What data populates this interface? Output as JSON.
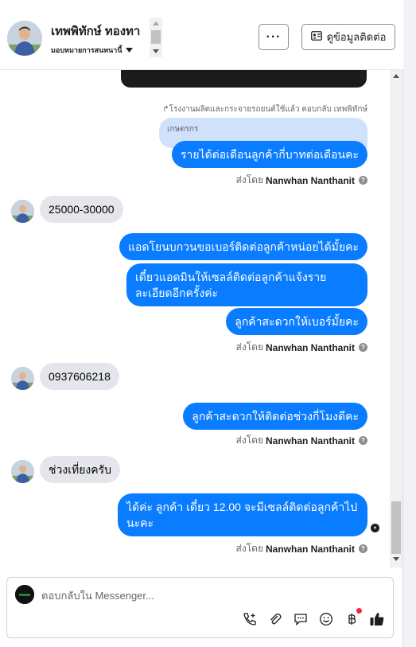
{
  "header": {
    "name": "เทพพิทักษ์ ทองทา",
    "assign_label": "มอบหมายการสนทนานี้",
    "more_label": "···",
    "contact_button_label": "ดูข้อมูลติดต่อ"
  },
  "chat": {
    "reply_note": "↱โรงงานผลิตและกระจายรถยนต์ใช้แล้ว ตอบกลับ เทพพิทักษ์",
    "quoted_text": "เกษตรกร",
    "sent_by_prefix": "ส่งโดย",
    "sender_name": "Nanwhan Nanthanit",
    "messages": [
      {
        "text": "รายได้ต่อเดือนลูกค้ากี่บาทต่อเดือนคะ"
      },
      {
        "text": "25000-30000"
      },
      {
        "text": "แอดโยนบกวนขอเบอร์ติดต่อลูกค้าหน่อยได้มั้ยคะ"
      },
      {
        "text": "เดี๋ยวแอดมินให้เซลล์ติดต่อลูกค้าแจ้งรายละเอียดอีกครั้งค่ะ"
      },
      {
        "text": "ลูกค้าสะดวกให้เบอร์มั้ยคะ"
      },
      {
        "text": "0937606218"
      },
      {
        "text": "ลูกค้าสะดวกให้ติดต่อช่วงกี่โมงดีคะ"
      },
      {
        "text": "ช่วงเที่ยงครับ"
      },
      {
        "text": "ได้ค่ะ ลูกค้า เดี๋ยว 12.00 จะมีเซลล์ติดต่อลูกค้าไปนะคะ"
      }
    ]
  },
  "composer": {
    "placeholder": "ตอบกลับใน Messenger..."
  },
  "icons": {
    "more": "ellipsis-icon",
    "contact": "contact-card-icon",
    "call": "phone-add-icon",
    "attach": "paperclip-icon",
    "saved_reply": "chat-bubble-icon",
    "emoji": "smiley-icon",
    "payment": "baht-icon",
    "like": "thumbs-up-icon"
  },
  "colors": {
    "outgoing_bubble": "#0a7cff",
    "incoming_bubble": "#e4e6eb",
    "quoted_bubble": "#cfe1fb",
    "like_icon": "#1c1e21",
    "badge": "#f02849"
  }
}
